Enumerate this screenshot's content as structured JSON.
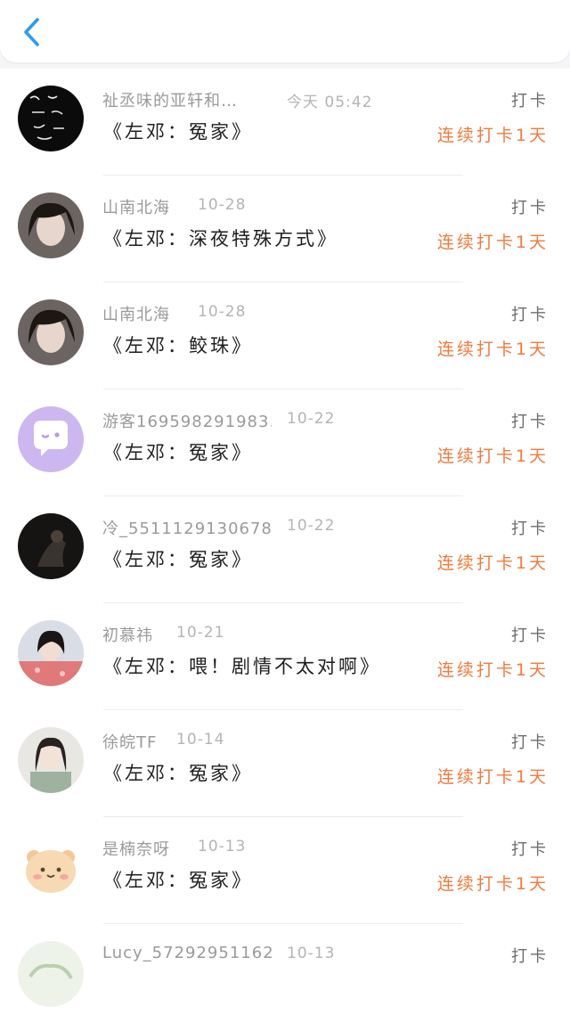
{
  "header": {
    "back_icon": "chevron-left-icon",
    "accent": "#2d9cf0"
  },
  "colors": {
    "streak": "#f07b3f"
  },
  "entries": [
    {
      "name": "祉丞味的亚轩和…",
      "time": "今天 05:42",
      "title": "《左邓：冤家》",
      "checkin": "打卡",
      "streak": "连续打卡1天"
    },
    {
      "name": "山南北海",
      "time": "10-28",
      "title": "《左邓：深夜特殊方式》",
      "checkin": "打卡",
      "streak": "连续打卡1天"
    },
    {
      "name": "山南北海",
      "time": "10-28",
      "title": "《左邓：鲛珠》",
      "checkin": "打卡",
      "streak": "连续打卡1天"
    },
    {
      "name": "游客169598291983…",
      "time": "10-22",
      "title": "《左邓：冤家》",
      "checkin": "打卡",
      "streak": "连续打卡1天"
    },
    {
      "name": "冷_5511129130678…",
      "time": "10-22",
      "title": "《左邓：冤家》",
      "checkin": "打卡",
      "streak": "连续打卡1天"
    },
    {
      "name": "初慕祎",
      "time": "10-21",
      "title": "《左邓：喂！剧情不太对啊》",
      "checkin": "打卡",
      "streak": "连续打卡1天"
    },
    {
      "name": "徐皖TF",
      "time": "10-14",
      "title": "《左邓：冤家》",
      "checkin": "打卡",
      "streak": "连续打卡1天"
    },
    {
      "name": "是楠奈呀",
      "time": "10-13",
      "title": "《左邓：冤家》",
      "checkin": "打卡",
      "streak": "连续打卡1天"
    },
    {
      "name": "Lucy_57292951162…",
      "time": "10-13",
      "title": "",
      "checkin": "打卡",
      "streak": ""
    }
  ]
}
